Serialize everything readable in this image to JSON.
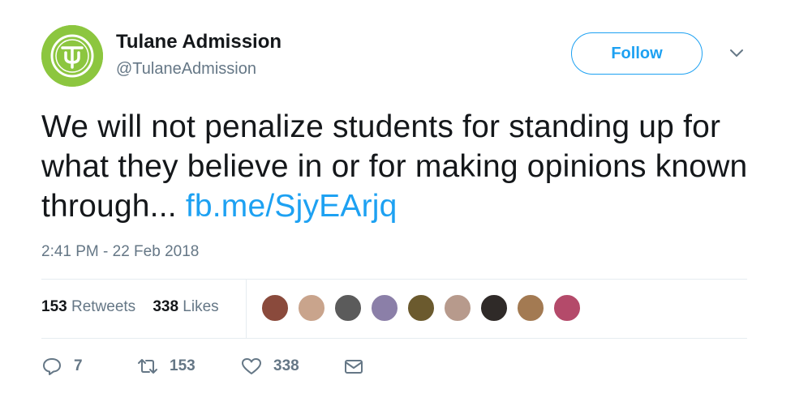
{
  "account": {
    "display_name": "Tulane Admission",
    "handle": "@TulaneAdmission",
    "avatar_color": "#8cc63f"
  },
  "follow_button": {
    "label": "Follow",
    "color": "#1da1f2"
  },
  "tweet": {
    "text": "We will not penalize students for standing up for what they believe in or for making opinions known through... ",
    "link": "fb.me/SjyEArjq",
    "timestamp": "2:41 PM - 22 Feb 2018"
  },
  "stats": {
    "retweets_count": "153",
    "retweets_label": "Retweets",
    "likes_count": "338",
    "likes_label": "Likes"
  },
  "likers": [
    "#8a4a3c",
    "#c9a48c",
    "#5b5b5b",
    "#8b7fa8",
    "#6b5a2e",
    "#b79a8c",
    "#2f2a28",
    "#a37a52",
    "#b44a6a"
  ],
  "actions": {
    "reply_count": "7",
    "retweet_count": "153",
    "like_count": "338"
  }
}
